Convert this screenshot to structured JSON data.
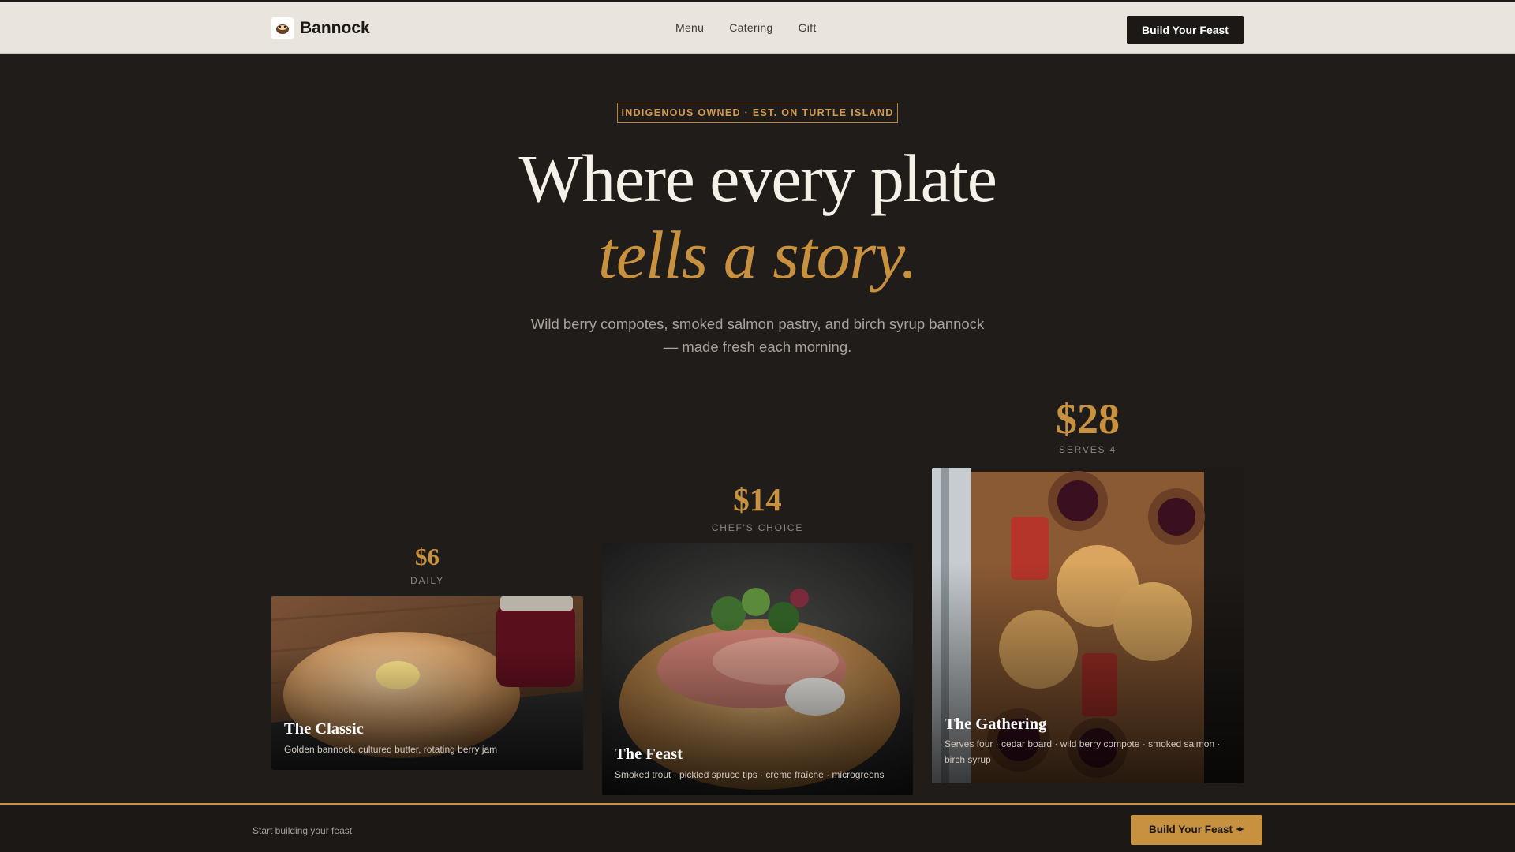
{
  "header": {
    "brand_name": "Bannock",
    "nav": [
      "Menu",
      "Catering",
      "Gift"
    ],
    "cta_label": "Build Your Feast"
  },
  "hero": {
    "badge": "INDIGENOUS OWNED · EST. ON TURTLE ISLAND",
    "headline_line1": "Where every plate",
    "headline_line2": "tells a story.",
    "subtitle_line1": "Wild berry compotes, smoked salmon pastry, and birch syrup bannock",
    "subtitle_line2": "— made fresh each morning."
  },
  "cards": [
    {
      "price": "$6",
      "label": "DAILY",
      "title": "The Classic",
      "desc": "Golden bannock, cultured butter, rotating berry jam"
    },
    {
      "price": "$14",
      "label": "CHEF'S CHOICE",
      "title": "The Feast",
      "desc": "Smoked trout · pickled spruce tips · crème fraîche · microgreens"
    },
    {
      "price": "$28",
      "label": "SERVES 4",
      "title": "The Gathering",
      "desc_line1": "Serves four · cedar board · wild berry compote · smoked salmon ·",
      "desc_line2": "birch syrup"
    }
  ],
  "footer_bar": {
    "text": "Start building your feast",
    "cta_label": "Build Your Feast ✦"
  },
  "colors": {
    "background": "#201c19",
    "accent_gold": "#c8913f",
    "header_bg": "#e9e4de",
    "dark_button": "#1b1816"
  }
}
